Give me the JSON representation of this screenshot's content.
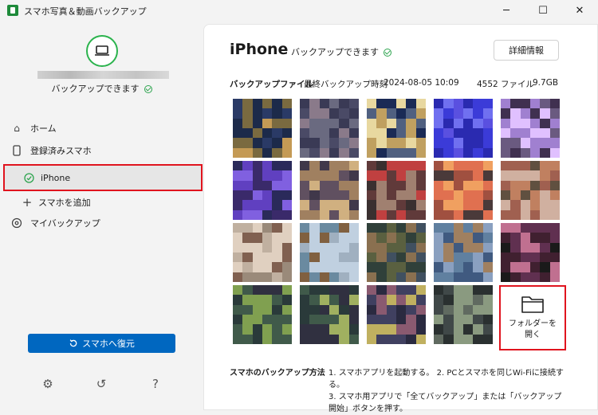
{
  "window": {
    "title": "スマホ写真＆動画バックアップ",
    "minimize_glyph": "─",
    "maximize_glyph": "☐",
    "close_glyph": "✕"
  },
  "sidebar": {
    "device_status": "バックアップできます",
    "nav": [
      {
        "label": "ホーム",
        "icon": "home-icon"
      },
      {
        "label": "登録済みスマホ",
        "icon": "phone-icon"
      },
      {
        "label": "iPhone",
        "icon": "check-circle-icon",
        "selected": true
      },
      {
        "label": "スマホを追加",
        "icon": "plus-icon"
      },
      {
        "label": "マイバックアップ",
        "icon": "backup-icon"
      }
    ],
    "restore_button": "スマホへ復元",
    "footer_icons": [
      "settings-icon",
      "history-icon",
      "help-icon"
    ],
    "help_glyph": "?"
  },
  "main": {
    "device_name": "iPhone",
    "status": "バックアップできます",
    "details_button": "詳細情報",
    "backup_files_label": "バックアップファイル",
    "last_backup_label": "最終バックアップ時刻",
    "last_backup_time": "2024-08-05 10:09",
    "file_count": "4552 ファイル",
    "size": "9.7GB",
    "folder_button_line1": "フォルダーを",
    "folder_button_line2": "開く",
    "howto_title": "スマホのバックアップ方法",
    "howto_step1": "1. スマホアプリを起動する。 2. PCとスマホを同じWi-Fiに接続する。",
    "howto_step2": "3. スマホ用アプリで「全てバックアップ」または「バックアップ開始」ボタンを押す。"
  },
  "thumbnail_palettes": [
    [
      "#2a3a66",
      "#c49a55",
      "#7a6a40",
      "#1c2a4a"
    ],
    [
      "#4a4a66",
      "#8a7a8a",
      "#6a6a80",
      "#3a3a55"
    ],
    [
      "#1a2a55",
      "#c0a060",
      "#e8d8a0",
      "#506080"
    ],
    [
      "#3b3bd8",
      "#5a50e0",
      "#2a2ab0",
      "#7070f0"
    ],
    [
      "#6a5a80",
      "#a080d0",
      "#403050",
      "#e0c0ff"
    ],
    [
      "#2a2a5a",
      "#6040c0",
      "#8060e0",
      "#3a2a6a"
    ],
    [
      "#40384a",
      "#a08060",
      "#605060",
      "#d0b080"
    ],
    [
      "#3a3030",
      "#c04040",
      "#a08070",
      "#603a3a"
    ],
    [
      "#4a3a3a",
      "#e07050",
      "#a05040",
      "#f0a060"
    ],
    [
      "#605040",
      "#c08060",
      "#a06050",
      "#d0b0a0"
    ],
    [
      "#9a8a7a",
      "#c0b0a0",
      "#806050",
      "#e0d0c0"
    ],
    [
      "#6a8aa0",
      "#c0d0e0",
      "#806040",
      "#a0b0c0"
    ],
    [
      "#30403a",
      "#5a6040",
      "#8a7050",
      "#405060"
    ],
    [
      "#405a80",
      "#8aa0c0",
      "#a08060",
      "#6080a0"
    ],
    [
      "#1a1a1a",
      "#402030",
      "#c07090",
      "#603050"
    ],
    [
      "#2a3a3a",
      "#405a4a",
      "#80a050",
      "#303040"
    ],
    [
      "#2a3a3a",
      "#405a4a",
      "#a0b060",
      "#303040"
    ],
    [
      "#2a2a40",
      "#8a5a70",
      "#c0b060",
      "#404060"
    ],
    [
      "#2a3030",
      "#606a60",
      "#8a9a80",
      "#404848"
    ]
  ],
  "icons": {
    "home": "⌂",
    "phone": "▯",
    "add": "+",
    "settings": "⚙",
    "history": "↺"
  },
  "colors": {
    "accent": "#0067c0",
    "success": "#2ea44f",
    "highlight": "#e0141e"
  }
}
